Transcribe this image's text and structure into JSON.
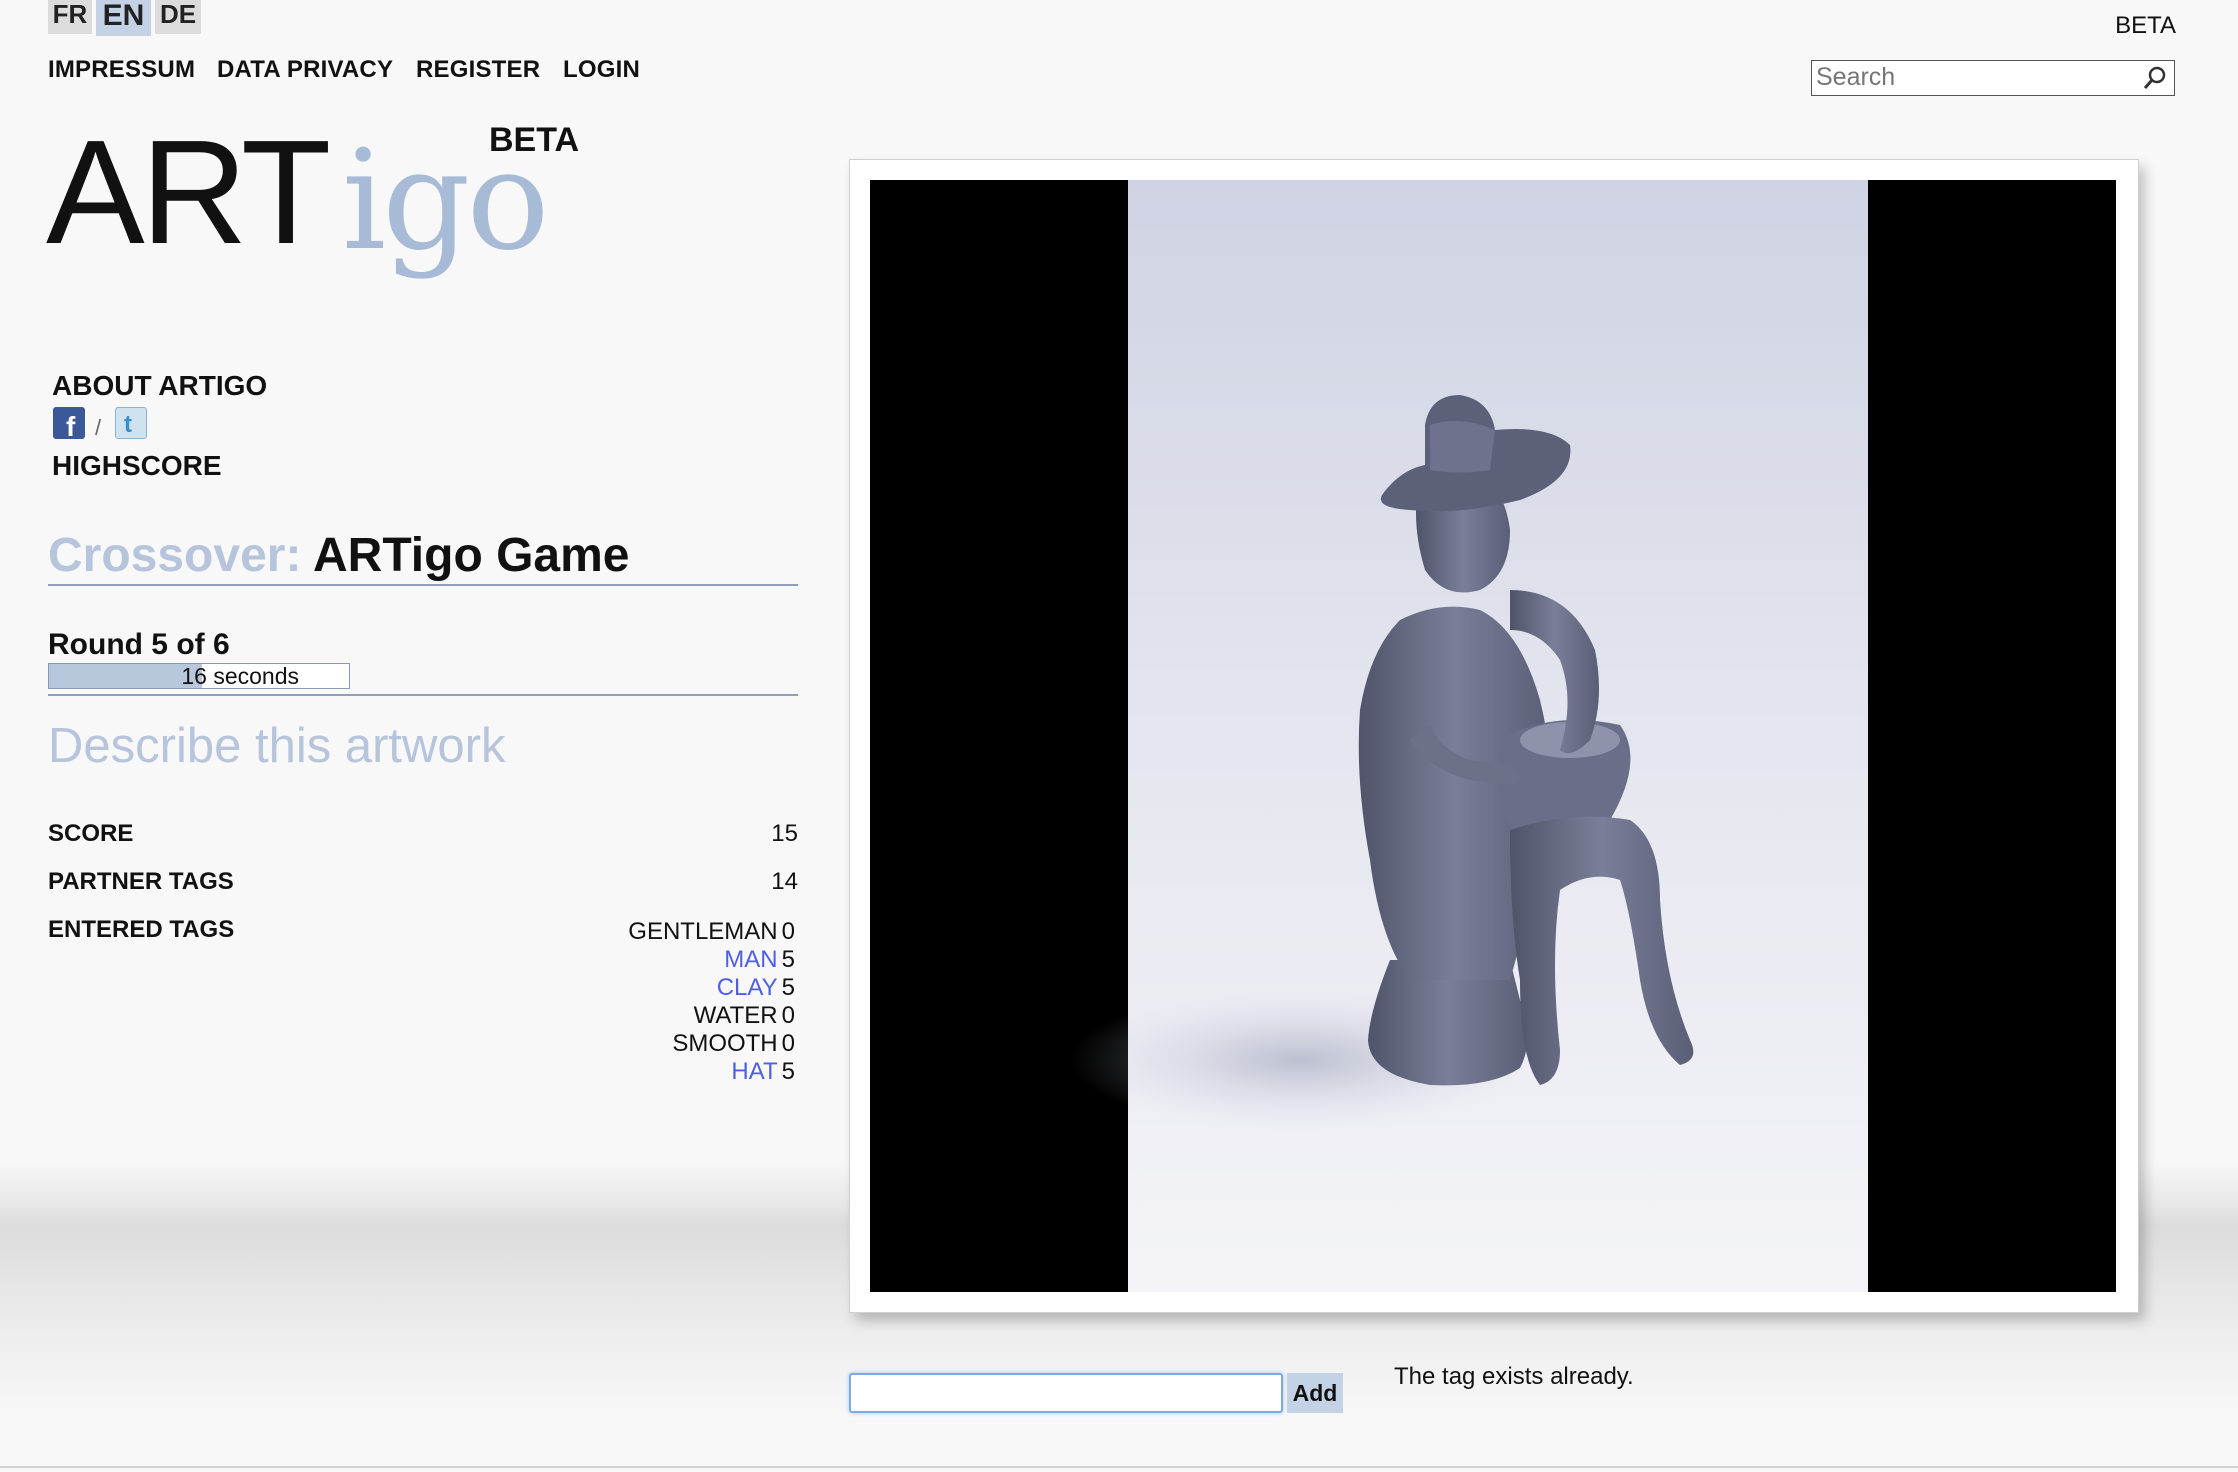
{
  "languages": [
    {
      "code": "FR",
      "active": false
    },
    {
      "code": "EN",
      "active": true
    },
    {
      "code": "DE",
      "active": false
    }
  ],
  "topnav": [
    "IMPRESSUM",
    "DATA PRIVACY",
    "REGISTER",
    "LOGIN"
  ],
  "header": {
    "beta": "BETA"
  },
  "search": {
    "placeholder": "Search"
  },
  "logo": {
    "art": "ART",
    "igo": "igo",
    "beta": "BETA"
  },
  "sidebar": {
    "about": "ABOUT ARTIGO",
    "highscore": "HIGHSCORE"
  },
  "social": {
    "facebook_icon": "facebook-icon",
    "twitter_icon": "twitter-icon"
  },
  "game": {
    "prefix": "Crossover:",
    "title": "ARTigo Game",
    "round": "Round 5 of 6",
    "timer": "16 seconds",
    "timer_fraction": 0.51,
    "prompt": "Describe this artwork"
  },
  "stats": {
    "score_label": "SCORE",
    "score": "15",
    "partner_label": "PARTNER TAGS",
    "partner": "14",
    "entered_label": "ENTERED TAGS"
  },
  "entered_tags": [
    {
      "word": "GENTLEMAN",
      "points": "0",
      "matched": false
    },
    {
      "word": "MAN",
      "points": "5",
      "matched": true
    },
    {
      "word": "CLAY",
      "points": "5",
      "matched": true
    },
    {
      "word": "WATER",
      "points": "0",
      "matched": false
    },
    {
      "word": "SMOOTH",
      "points": "0",
      "matched": false
    },
    {
      "word": "HAT",
      "points": "5",
      "matched": true
    }
  ],
  "tag_entry": {
    "value": "",
    "add_label": "Add",
    "message": "The tag exists already."
  },
  "colors": {
    "accent_light": "#b6c5dc",
    "matched_tag": "#4e5fe0",
    "active_lang": "#c4d2e6"
  }
}
